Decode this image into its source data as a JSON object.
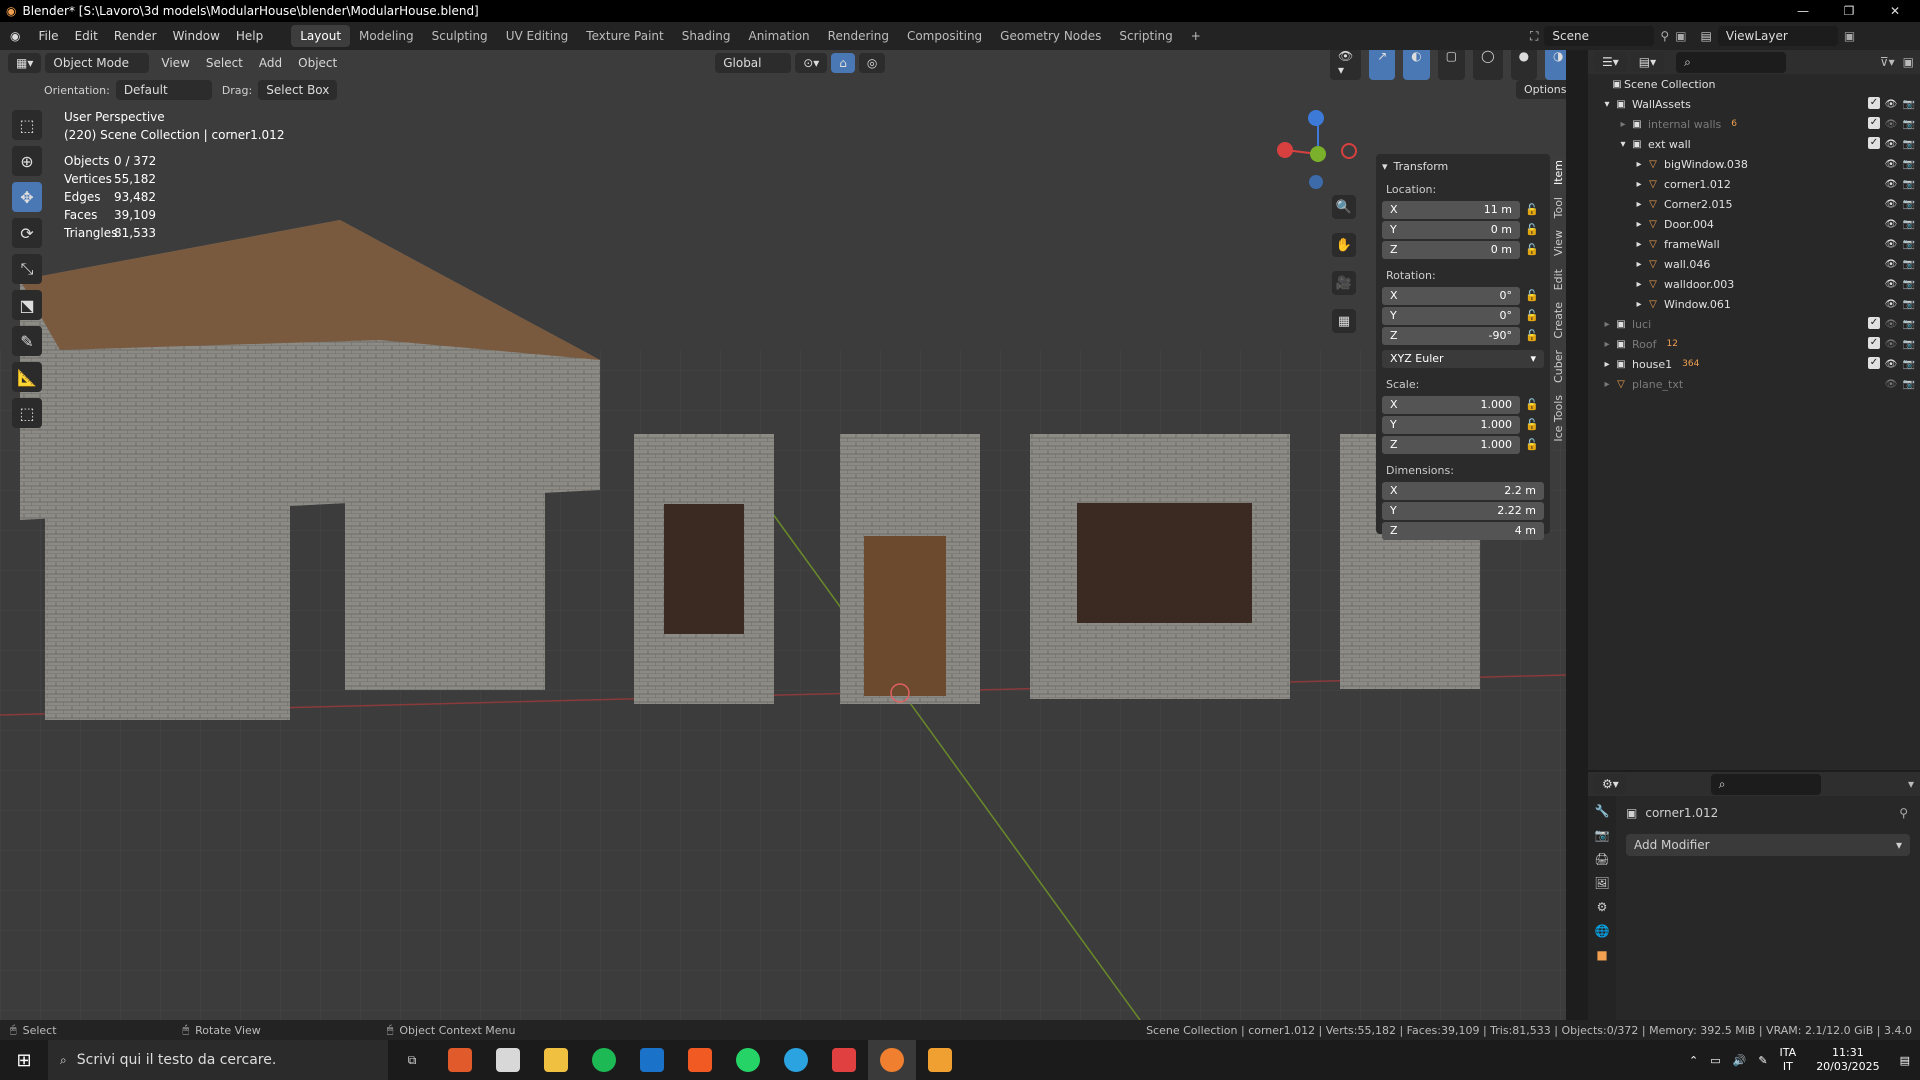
{
  "title": "Blender* [S:\\Lavoro\\3d models\\ModularHouse\\blender\\ModularHouse.blend]",
  "menus": [
    "File",
    "Edit",
    "Render",
    "Window",
    "Help"
  ],
  "workspaces": [
    {
      "label": "Layout",
      "active": true
    },
    {
      "label": "Modeling"
    },
    {
      "label": "Sculpting"
    },
    {
      "label": "UV Editing"
    },
    {
      "label": "Texture Paint"
    },
    {
      "label": "Shading"
    },
    {
      "label": "Animation"
    },
    {
      "label": "Rendering"
    },
    {
      "label": "Compositing"
    },
    {
      "label": "Geometry Nodes"
    },
    {
      "label": "Scripting"
    }
  ],
  "scene": "Scene",
  "view_layer": "ViewLayer",
  "viewport_header": {
    "mode": "Object Mode",
    "menus": [
      "View",
      "Select",
      "Add",
      "Object"
    ],
    "transform": "Global",
    "orientation_label": "Orientation:",
    "orientation_value": "Default",
    "drag_label": "Drag:",
    "drag_value": "Select Box",
    "options": "Options"
  },
  "overlay_text": {
    "perspective": "User Perspective",
    "collection": "(220) Scene Collection | corner1.012"
  },
  "stats": [
    {
      "k": "Objects",
      "v": "0 / 372"
    },
    {
      "k": "Vertices",
      "v": "55,182"
    },
    {
      "k": "Edges",
      "v": "93,482"
    },
    {
      "k": "Faces",
      "v": "39,109"
    },
    {
      "k": "Triangles",
      "v": "81,533"
    }
  ],
  "transform": {
    "header": "Transform",
    "location_label": "Location:",
    "location": [
      {
        "axis": "X",
        "v": "11 m"
      },
      {
        "axis": "Y",
        "v": "0 m"
      },
      {
        "axis": "Z",
        "v": "0 m"
      }
    ],
    "rotation_label": "Rotation:",
    "rotation": [
      {
        "axis": "X",
        "v": "0°"
      },
      {
        "axis": "Y",
        "v": "0°"
      },
      {
        "axis": "Z",
        "v": "-90°"
      }
    ],
    "rotation_mode": "XYZ Euler",
    "scale_label": "Scale:",
    "scale": [
      {
        "axis": "X",
        "v": "1.000"
      },
      {
        "axis": "Y",
        "v": "1.000"
      },
      {
        "axis": "Z",
        "v": "1.000"
      }
    ],
    "dimensions_label": "Dimensions:",
    "dimensions": [
      {
        "axis": "X",
        "v": "2.2 m"
      },
      {
        "axis": "Y",
        "v": "2.22 m"
      },
      {
        "axis": "Z",
        "v": "4 m"
      }
    ]
  },
  "npanel_tabs": [
    "Item",
    "Tool",
    "View",
    "Edit",
    "Create",
    "Cuber",
    "Ice Tools"
  ],
  "outliner": {
    "root": "Scene Collection",
    "rows": [
      {
        "label": "WallAssets",
        "kind": "collection",
        "depth": 0,
        "open": true
      },
      {
        "label": "internal walls",
        "kind": "collection",
        "depth": 1,
        "dim": true,
        "badge": "6"
      },
      {
        "label": "ext wall",
        "kind": "collection",
        "depth": 1,
        "open": true
      },
      {
        "label": "bigWindow.038",
        "kind": "mesh",
        "depth": 2
      },
      {
        "label": "corner1.012",
        "kind": "mesh",
        "depth": 2
      },
      {
        "label": "Corner2.015",
        "kind": "mesh",
        "depth": 2
      },
      {
        "label": "Door.004",
        "kind": "mesh",
        "depth": 2
      },
      {
        "label": "frameWall",
        "kind": "mesh",
        "depth": 2
      },
      {
        "label": "wall.046",
        "kind": "mesh",
        "depth": 2
      },
      {
        "label": "walldoor.003",
        "kind": "mesh",
        "depth": 2
      },
      {
        "label": "Window.061",
        "kind": "mesh",
        "depth": 2
      },
      {
        "label": "luci",
        "kind": "collection",
        "depth": 0,
        "dim": true
      },
      {
        "label": "Roof",
        "kind": "collection",
        "depth": 0,
        "dim": true,
        "badge": "12"
      },
      {
        "label": "house1",
        "kind": "collection",
        "depth": 0,
        "badge": "364"
      },
      {
        "label": "plane_txt",
        "kind": "mesh",
        "depth": 0,
        "dim": true
      }
    ]
  },
  "properties": {
    "object": "corner1.012",
    "add_modifier": "Add Modifier"
  },
  "statusbar": {
    "left": [
      {
        "icon": "mouse-left-icon",
        "label": "Select"
      },
      {
        "icon": "mouse-middle-icon",
        "label": "Rotate View"
      },
      {
        "icon": "mouse-right-icon",
        "label": "Object Context Menu"
      }
    ],
    "right": "Scene Collection | corner1.012 | Verts:55,182 | Faces:39,109 | Tris:81,533 | Objects:0/372 | Memory: 392.5 MiB | VRAM: 2.1/12.0 GiB | 3.4.0"
  },
  "taskbar": {
    "search_placeholder": "Scrivi qui il testo da cercare.",
    "lang": "ITA",
    "lang2": "IT",
    "time": "11:31",
    "date": "20/03/2025"
  }
}
